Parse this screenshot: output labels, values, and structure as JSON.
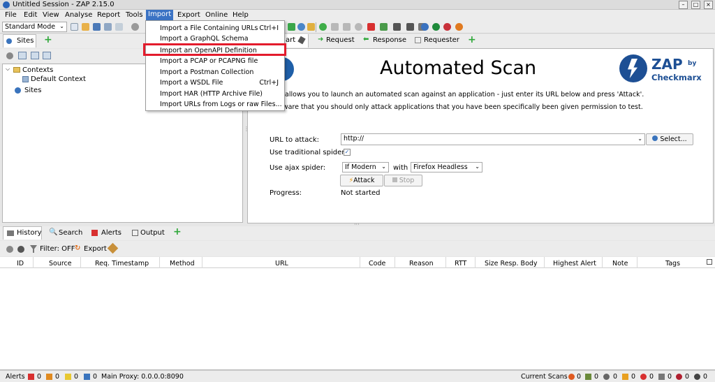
{
  "window": {
    "title": "Untitled Session - ZAP 2.15.0"
  },
  "menu": [
    "File",
    "Edit",
    "View",
    "Analyse",
    "Report",
    "Tools",
    "Import",
    "Export",
    "Online",
    "Help"
  ],
  "toolbar": {
    "mode": "Standard Mode"
  },
  "sites_tab": {
    "label": "Sites",
    "tree": {
      "contexts": "Contexts",
      "default_context": "Default Context",
      "sites": "Sites"
    }
  },
  "right_tabs": {
    "quickstart": "art",
    "request": "Request",
    "response": "Response",
    "requester": "Requester"
  },
  "import_menu": [
    {
      "label": "Import a File Containing URLs",
      "shortcut": "Ctrl+I"
    },
    {
      "label": "Import a GraphQL Schema",
      "shortcut": ""
    },
    {
      "label": "Import an OpenAPI Definition",
      "shortcut": ""
    },
    {
      "label": "Import a PCAP or PCAPNG file",
      "shortcut": ""
    },
    {
      "label": "Import a Postman Collection",
      "shortcut": ""
    },
    {
      "label": "Import a WSDL File",
      "shortcut": "Ctrl+J"
    },
    {
      "label": "Import HAR (HTTP Archive File)",
      "shortcut": ""
    },
    {
      "label": "Import URLs from Logs or raw Files...",
      "shortcut": ""
    }
  ],
  "scan": {
    "heading": "Automated Scan",
    "desc1": "n allows you to launch an automated scan against  an application - just enter its URL below and press 'Attack'.",
    "desc2": "aware that you should only attack applications that you have been specifically been given permission to test.",
    "url_label": "URL to attack:",
    "url_value": "http://",
    "select_btn": "Select...",
    "trad_spider_label": "Use traditional spider:",
    "ajax_label": "Use ajax spider:",
    "ajax_mode": "If Modern",
    "with": "with",
    "browser": "Firefox Headless",
    "attack": "Attack",
    "stop": "Stop",
    "progress_label": "Progress:",
    "progress_value": "Not started"
  },
  "logo": {
    "zap": "ZAP",
    "by": "by",
    "brand": "Checkmarx"
  },
  "bottom_tabs": {
    "history": "History",
    "search": "Search",
    "alerts": "Alerts",
    "output": "Output"
  },
  "history_toolbar": {
    "filter": "Filter: OFF",
    "export": "Export"
  },
  "columns": [
    "ID",
    "Source",
    "Req. Timestamp",
    "Method",
    "URL",
    "Code",
    "Reason",
    "RTT",
    "Size Resp. Body",
    "Highest Alert",
    "Note",
    "Tags"
  ],
  "status": {
    "alerts_label": "Alerts",
    "alert_counts": [
      "0",
      "0",
      "0",
      "0"
    ],
    "proxy": "Main Proxy: 0.0.0.0:8090",
    "current_scans": "Current Scans",
    "scan_counts": [
      "0",
      "0",
      "0",
      "0",
      "0",
      "0",
      "0",
      "0"
    ]
  },
  "colors": {
    "highlight": "#e31b2c",
    "menu_active": "#3b73c4",
    "add_green": "#2fa83a"
  }
}
